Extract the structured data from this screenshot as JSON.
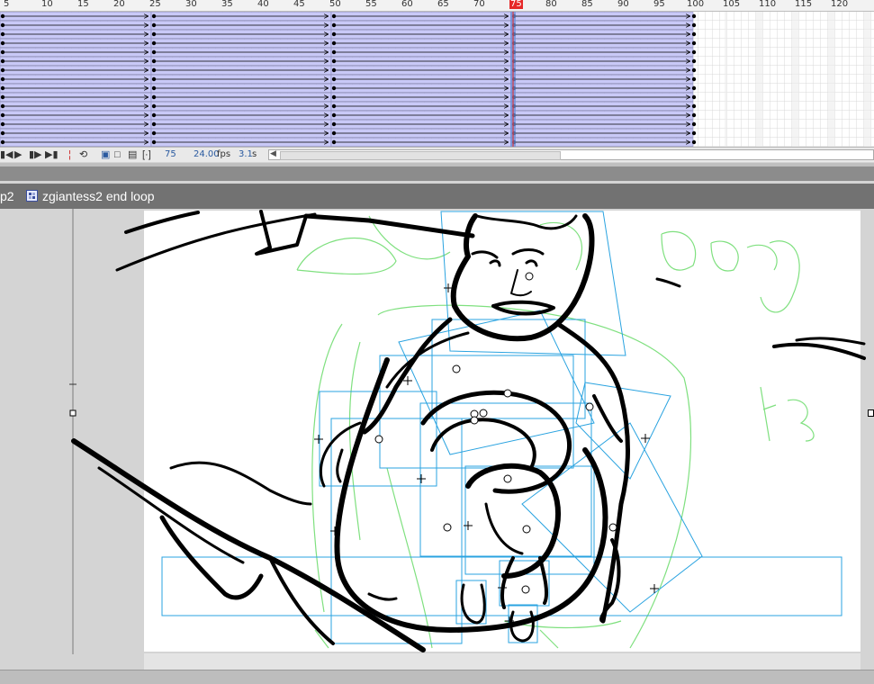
{
  "timeline": {
    "ruler_labels": [
      "5",
      "10",
      "15",
      "20",
      "25",
      "30",
      "35",
      "40",
      "45",
      "50",
      "55",
      "60",
      "65",
      "70",
      "75",
      "80",
      "85",
      "90",
      "95",
      "100",
      "105",
      "110",
      "115",
      "120"
    ],
    "current_frame": "75",
    "fps": "24.00",
    "fps_unit": "fps",
    "elapsed": "3.1",
    "elapsed_unit": "s",
    "colors": {
      "tween_fill": "#c9c9f7",
      "playhead": "#e62828",
      "readout": "#2a5aa0"
    }
  },
  "controls": {
    "rewind_icon": "step-to-start-icon",
    "play_icon": "play-icon",
    "step_forward_icon": "step-forward-icon",
    "to_end_icon": "step-to-end-icon",
    "center_frame_icon": "center-frame-icon",
    "loop_icon": "loop-icon",
    "onion_icon": "onion-skin-icon",
    "onion_outline_icon": "onion-outline-icon",
    "edit_multiple_icon": "edit-multiple-frames-icon",
    "modify_markers_icon": "modify-onion-markers-icon"
  },
  "breadcrumb": {
    "previous": "p2",
    "current": "zgiantess2 end loop",
    "current_icon": "movieclip-symbol-icon"
  },
  "stage": {
    "background": "#ffffff",
    "onion_color": "#7fe07f",
    "selection_color": "#2aa3e0"
  }
}
